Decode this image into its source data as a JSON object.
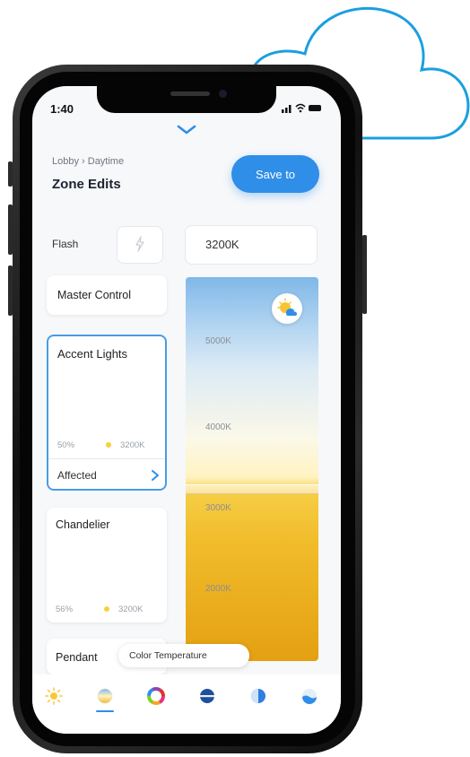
{
  "status_bar": {
    "time": "1:40",
    "icons": "signal wifi battery"
  },
  "header": {
    "breadcrumb": "Lobby › Daytime",
    "title": "Zone Edits",
    "save_label": "Save to"
  },
  "flash": {
    "label": "Flash",
    "icon": "lightning-icon"
  },
  "temperature": {
    "value": "3200K"
  },
  "zones": {
    "master": {
      "name": "Master Control"
    },
    "accent": {
      "name": "Accent Lights",
      "brightness": "50%",
      "temp": "3200K",
      "affected_label": "Affected",
      "selected": true
    },
    "chandelier": {
      "name": "Chandelier",
      "brightness": "56%",
      "temp": "3200K"
    },
    "pendant": {
      "name": "Pendant"
    }
  },
  "gradient_scale": {
    "ticks": [
      "5000K",
      "4000K",
      "3000K",
      "2000K"
    ]
  },
  "tooltip": {
    "text": "Color Temperature"
  },
  "tabs": [
    {
      "name": "brightness-icon"
    },
    {
      "name": "color-temperature-icon",
      "active": true
    },
    {
      "name": "color-wheel-icon"
    },
    {
      "name": "scene-icon"
    },
    {
      "name": "half-circle-icon"
    },
    {
      "name": "effect-icon"
    }
  ],
  "colors": {
    "accent": "#2f8ee8",
    "cloud": "#1a9fe0",
    "selection": "#4a9be6"
  }
}
